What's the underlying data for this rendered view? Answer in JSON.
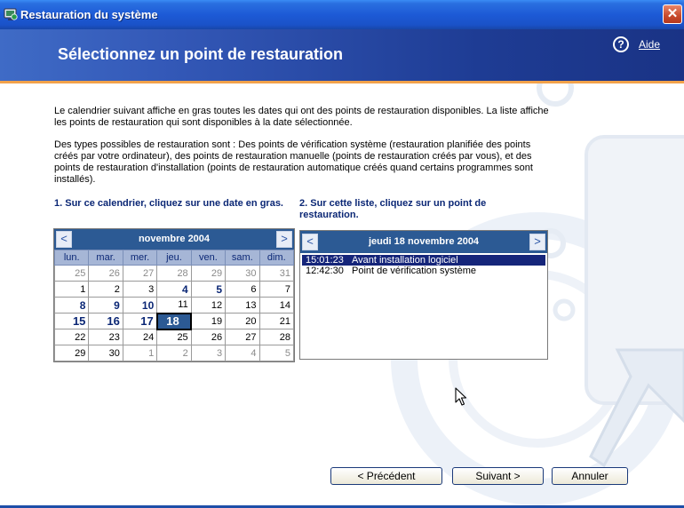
{
  "window": {
    "title": "Restauration du système",
    "close_label": "✕"
  },
  "header": {
    "title": "Sélectionnez un point de restauration",
    "help_label": "Aide",
    "help_icon_glyph": "?"
  },
  "intro": {
    "paragraph1": "Le calendrier suivant affiche en gras toutes les dates qui ont des points de restauration disponibles. La liste affiche les points de restauration qui sont disponibles à la date sélectionnée.",
    "paragraph2": "Des types possibles de restauration sont : Des points de vérification système (restauration planifiée des points créés par votre ordinateur), des points de restauration manuelle (points de restauration créés par vous), et des points de restauration d'installation (points de restauration automatique créés quand certains programmes sont installés)."
  },
  "step1_label": "1. Sur ce calendrier, cliquez sur une date en gras.",
  "step2_label": "2. Sur cette liste, cliquez sur un point de restauration.",
  "calendar": {
    "month": "novembre 2004",
    "prev": "<",
    "next": ">",
    "weekdays": [
      "lun.",
      "mar.",
      "mer.",
      "jeu.",
      "ven.",
      "sam.",
      "dim."
    ],
    "weeks": [
      [
        "25",
        "26",
        "27",
        "28",
        "29",
        "30",
        "31"
      ],
      [
        "1",
        "2",
        "3",
        "4",
        "5",
        "6",
        "7"
      ],
      [
        "8",
        "9",
        "10",
        "11",
        "12",
        "13",
        "14"
      ],
      [
        "15",
        "16",
        "17",
        "18",
        "19",
        "20",
        "21"
      ],
      [
        "22",
        "23",
        "24",
        "25",
        "26",
        "27",
        "28"
      ],
      [
        "29",
        "30",
        "1",
        "2",
        "3",
        "4",
        "5"
      ]
    ],
    "selected": "18"
  },
  "list": {
    "date": "jeudi 18 novembre 2004",
    "prev": "<",
    "next": ">",
    "items": [
      {
        "time": "15:01:23",
        "description": "Avant installation logiciel"
      },
      {
        "time": "12:42:30",
        "description": "Point de vérification système"
      }
    ]
  },
  "buttons": {
    "previous": "< Précédent",
    "next": "Suivant >",
    "cancel": "Annuler"
  },
  "colors": {
    "titlebar": "#1d5ad6",
    "header": "#1e3c94",
    "accent_rule": "#f2a24a",
    "calendar_header": "#2c5a94",
    "bold_date": "#0b2775"
  }
}
